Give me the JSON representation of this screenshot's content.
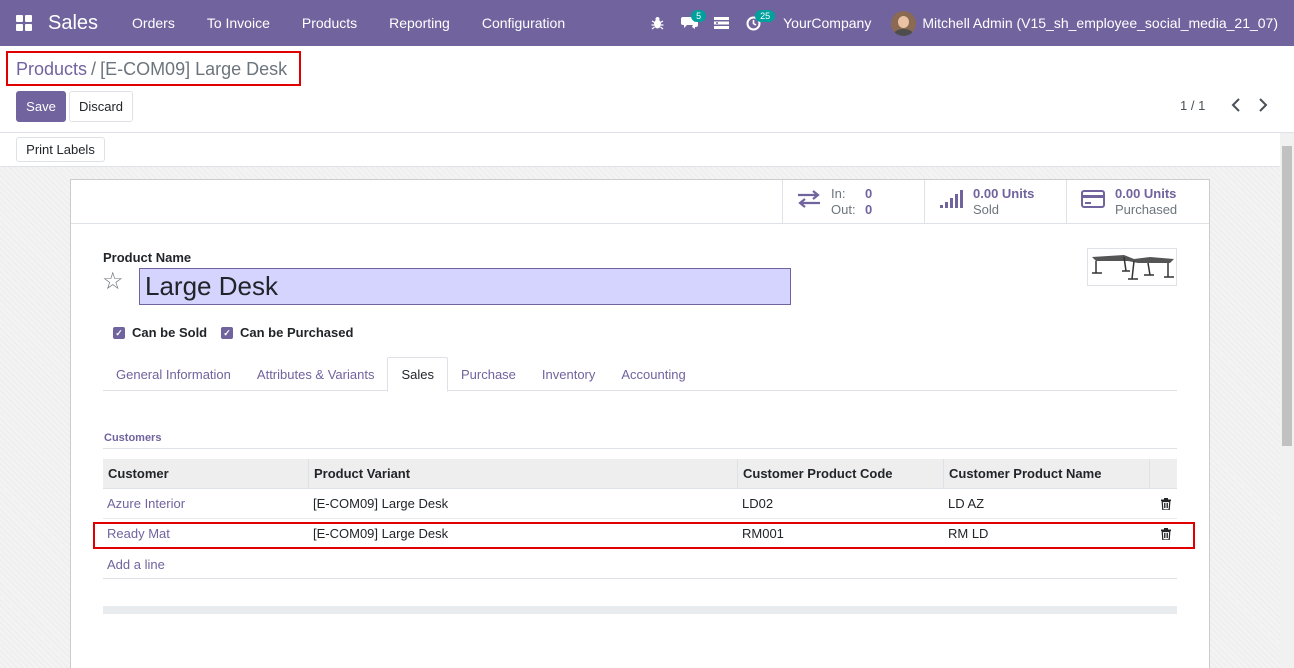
{
  "navbar": {
    "app_name": "Sales",
    "menu": [
      "Orders",
      "To Invoice",
      "Products",
      "Reporting",
      "Configuration"
    ],
    "chat_badge": "5",
    "activity_badge": "25",
    "company": "YourCompany",
    "user": "Mitchell Admin (V15_sh_employee_social_media_21_07)"
  },
  "breadcrumb": {
    "parent": "Products",
    "separator": "/",
    "current": "[E-COM09] Large Desk"
  },
  "buttons": {
    "save": "Save",
    "discard": "Discard",
    "print_labels": "Print Labels"
  },
  "pager": {
    "value": "1 / 1"
  },
  "smart_buttons": {
    "in_label": "In:",
    "in_value": "0",
    "out_label": "Out:",
    "out_value": "0",
    "sold_value": "0.00 Units",
    "sold_label": "Sold",
    "purchased_value": "0.00 Units",
    "purchased_label": "Purchased"
  },
  "form": {
    "product_name_label": "Product Name",
    "product_name": "Large Desk",
    "can_be_sold": "Can be Sold",
    "can_be_purchased": "Can be Purchased"
  },
  "tabs": [
    "General Information",
    "Attributes & Variants",
    "Sales",
    "Purchase",
    "Inventory",
    "Accounting"
  ],
  "active_tab": "Sales",
  "customers": {
    "section_title": "Customers",
    "columns": [
      "Customer",
      "Product Variant",
      "Customer Product Code",
      "Customer Product Name"
    ],
    "rows": [
      {
        "customer": "Azure Interior",
        "variant": "[E-COM09] Large Desk",
        "code": "LD02",
        "name": "LD AZ"
      },
      {
        "customer": "Ready Mat",
        "variant": "[E-COM09] Large Desk",
        "code": "RM001",
        "name": "RM LD"
      }
    ],
    "add_line": "Add a line"
  },
  "colors": {
    "brand": "#71639e",
    "highlight": "#e00000",
    "input_bg": "#d4d4ff"
  }
}
